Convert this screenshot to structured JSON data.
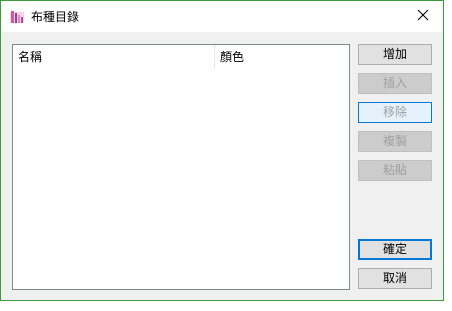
{
  "window": {
    "title": "布種目錄",
    "accent": "#3c9c3c",
    "app_icon": "fabric-catalog-icon",
    "close_icon": "close-icon"
  },
  "list": {
    "columns": [
      "名稱",
      "顏色"
    ],
    "rows": []
  },
  "buttons": {
    "add": "增加",
    "insert": "插入",
    "remove": "移除",
    "copy": "複製",
    "paste": "粘貼",
    "ok": "確定",
    "cancel": "取消"
  }
}
